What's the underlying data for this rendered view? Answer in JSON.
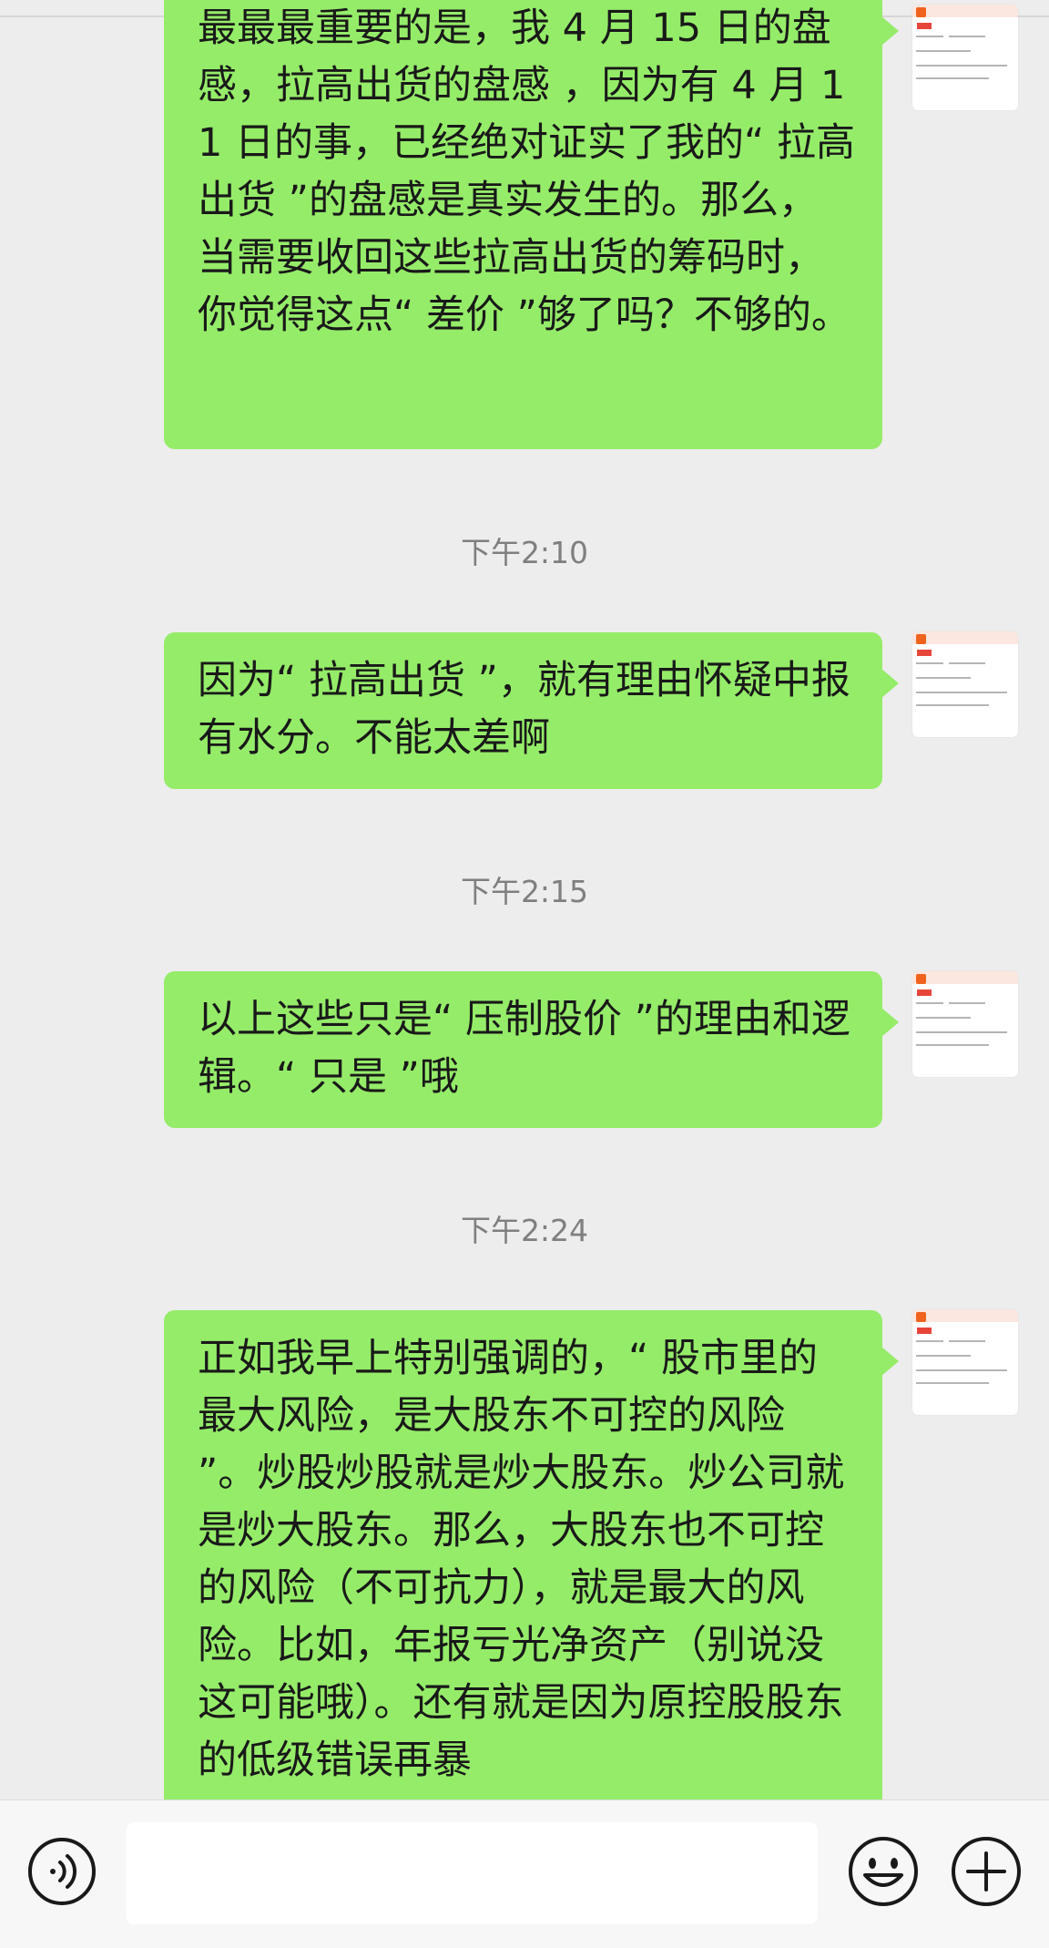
{
  "messages": [
    {
      "type": "sent",
      "text": "最最最重要的是，我 4 月 15 日的盘感，拉高出货的盘感 ，因为有 4 月 11 日的事，已经绝对证实了我的“ 拉高出货 ”的盘感是真实发生的。那么，当需要收回这些拉高出货的筹码时，你觉得这点“ 差价 ”够了吗？不够的。"
    },
    {
      "type": "time",
      "text": "下午2:10"
    },
    {
      "type": "sent",
      "text": "因为“ 拉高出货 ”，就有理由怀疑中报有水分。不能太差啊"
    },
    {
      "type": "time",
      "text": "下午2:15"
    },
    {
      "type": "sent",
      "text": "以上这些只是“ 压制股价 ”的理由和逻辑。“ 只是 ”哦"
    },
    {
      "type": "time",
      "text": "下午2:24"
    },
    {
      "type": "sent",
      "text": "正如我早上特别强调的，“ 股市里的最大风险，是大股东不可控的风险 ”。炒股炒股就是炒大股东。炒公司就是炒大股东。那么，大股东也不可控的风险（不可抗力），就是最大的风险。比如，年报亏光净资产（别说没这可能哦）。还有就是因为原控股股东的低级错误再暴"
    }
  ],
  "input_bar": {
    "voice_icon": "voice-icon",
    "emoji_icon": "emoji-icon",
    "plus_icon": "plus-icon",
    "input_value": ""
  },
  "colors": {
    "background": "#ededed",
    "sent_bubble": "#95ec69",
    "time_text": "#7f7f7f",
    "bottom_bar": "#f7f7f7"
  }
}
